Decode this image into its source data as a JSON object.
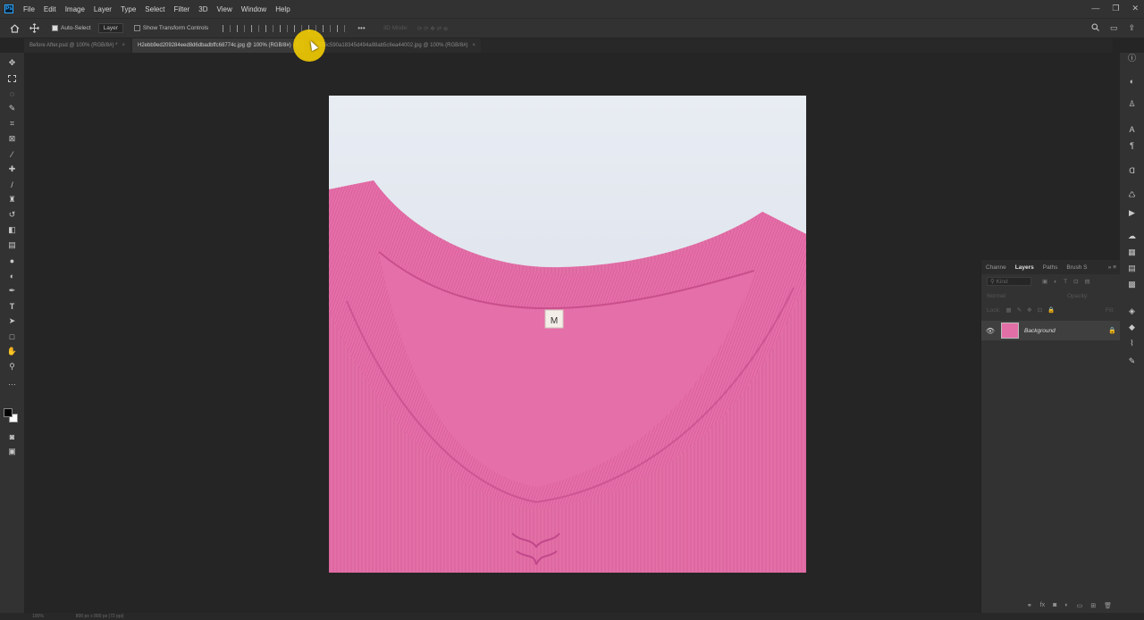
{
  "app": {
    "logo": "Ps"
  },
  "menu": [
    "File",
    "Edit",
    "Image",
    "Layer",
    "Type",
    "Select",
    "Filter",
    "3D",
    "View",
    "Window",
    "Help"
  ],
  "window_controls": {
    "minimize": "—",
    "restore": "❐",
    "close": "✕"
  },
  "options": {
    "auto_select_label": "Auto-Select",
    "auto_select_checked": true,
    "target_value": "Layer",
    "transform_label": "Show Transform Controls",
    "more": "•••",
    "mode_3d": "3D Mode:"
  },
  "tabs": [
    {
      "label": "Before After.psd @ 100% (RGB/8#) *",
      "active": false
    },
    {
      "label": "H2ebb9ed209284eed8d6dbadbffc68774c.jpg @ 100% (RGB/8#)",
      "active": true
    },
    {
      "label": "H5576c590a18345d494a98ab5c6ea44002.jpg @ 100% (RGB/8#)",
      "active": false
    }
  ],
  "tab_close": "×",
  "layers_panel": {
    "tabs": [
      "Channe",
      "Layers",
      "Paths",
      "Brush S"
    ],
    "active_tab": "Layers",
    "search_placeholder": "Kind",
    "blend_mode": "Normal",
    "opacity_label": "Opacity:",
    "lock_label": "Lock:",
    "fill_label": "Fill:",
    "layers": [
      {
        "name": "Background",
        "visible": true,
        "locked": true
      }
    ]
  },
  "document": {
    "size_tag": "M"
  },
  "status": {
    "zoom": "100%",
    "doc_info": "800 px x 800 px (72 ppi)"
  },
  "colors": {
    "shirt": "#e36fa7",
    "backdrop": "#dfe4ec",
    "highlight": "#ffd600"
  }
}
